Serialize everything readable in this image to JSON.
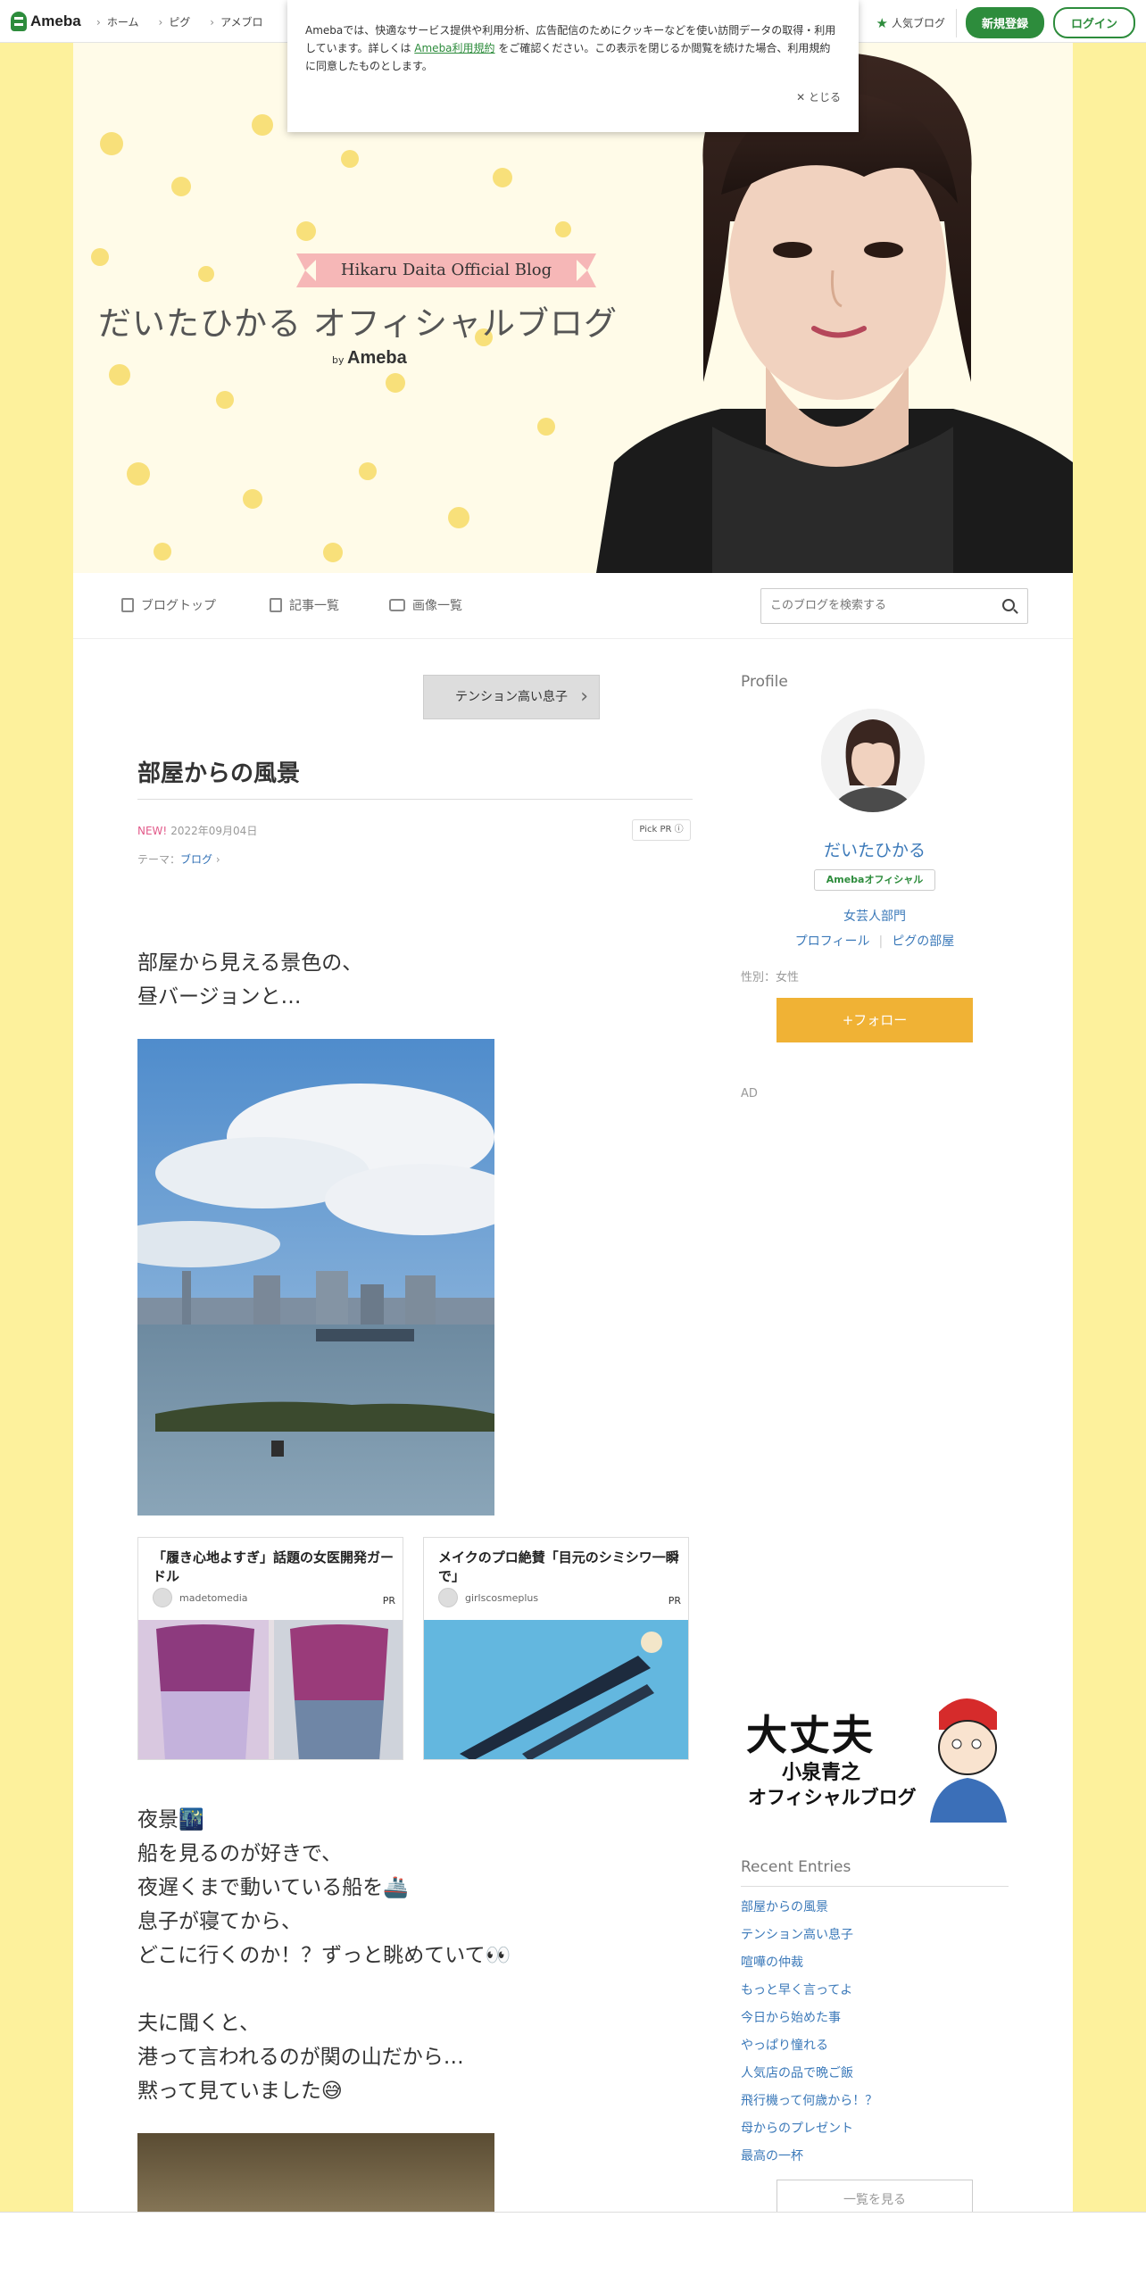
{
  "topbar": {
    "logo_text": "Ameba",
    "nav": [
      "ホーム",
      "ピグ",
      "アメブロ"
    ],
    "ranking": "人気ブログ",
    "register": "新規登録",
    "login": "ログイン"
  },
  "cookie": {
    "text_1": "Amebaでは、快適なサービス提供や利用分析、広告配信のためにクッキーなどを使い訪問データの取得・利用しています。詳しくは",
    "link": "Ameba利用規約",
    "text_2": "をご確認ください。この表示を閉じるか閲覧を続けた場合、利用規約に同意したものとします。",
    "close": "とじる"
  },
  "header": {
    "badge": "Hikaru Daita Official Blog",
    "title": "だいたひかる オフィシャルブログ",
    "by": "by",
    "by_brand": "Ameba"
  },
  "blognav": {
    "items": [
      "ブログトップ",
      "記事一覧",
      "画像一覧"
    ],
    "search_placeholder": "このブログを検索する"
  },
  "entry": {
    "prev_link": "テンション高い息子",
    "title": "部屋からの風景",
    "new_label": "NEW!",
    "date": "2022年09月04日",
    "pick_pr": "Pick PR ⓘ",
    "theme_label": "テーマ：",
    "theme": "ブログ",
    "para1": "部屋から見える景色の、\n昼バージョンと…",
    "para2": "夜景🌃\n船を見るのが好きで、\n夜遅くまで動いている船を🚢\n息子が寝てから、\nどこに行くのか！？ずっと眺めていて👀",
    "para3": "夫に聞くと、\n港って言われるのが関の山だから…\n黙って見ていました😅"
  },
  "ads": [
    {
      "title": "「履き心地よすぎ」話題の女医開発ガードル",
      "source": "madetomedia",
      "pr": "PR"
    },
    {
      "title": "メイクのプロ絶賛「目元のシミシワ一瞬で」",
      "source": "girlscosmeplus",
      "pr": "PR"
    }
  ],
  "sidebar": {
    "profile_heading": "Profile",
    "name": "だいたひかる",
    "official_tag": "Amebaオフィシャル",
    "genre": "女芸人部門",
    "link_profile": "プロフィール",
    "link_pig": "ピグの部屋",
    "gender": "性別：女性",
    "follow": "+フォロー",
    "ad_label": "AD",
    "banner_line1": "大丈夫",
    "banner_line2": "小泉青之",
    "banner_line3": "オフィシャルブログ",
    "recent_heading": "Recent Entries",
    "recent": [
      "部屋からの風景",
      "テンション高い息子",
      "喧嘩の仲裁",
      "もっと早く言ってよ",
      "今日から始めた事",
      "やっぱり憧れる",
      "人気店の品で晩ご飯",
      "飛行機って何歳から！？",
      "母からのプレゼント",
      "最高の一杯"
    ],
    "more": "一覧を見る"
  },
  "colors": {
    "brand_green": "#2d8c3c",
    "follow_orange": "#f0b235",
    "link_blue": "#3b79b9",
    "page_bg": "#fdf19c"
  }
}
